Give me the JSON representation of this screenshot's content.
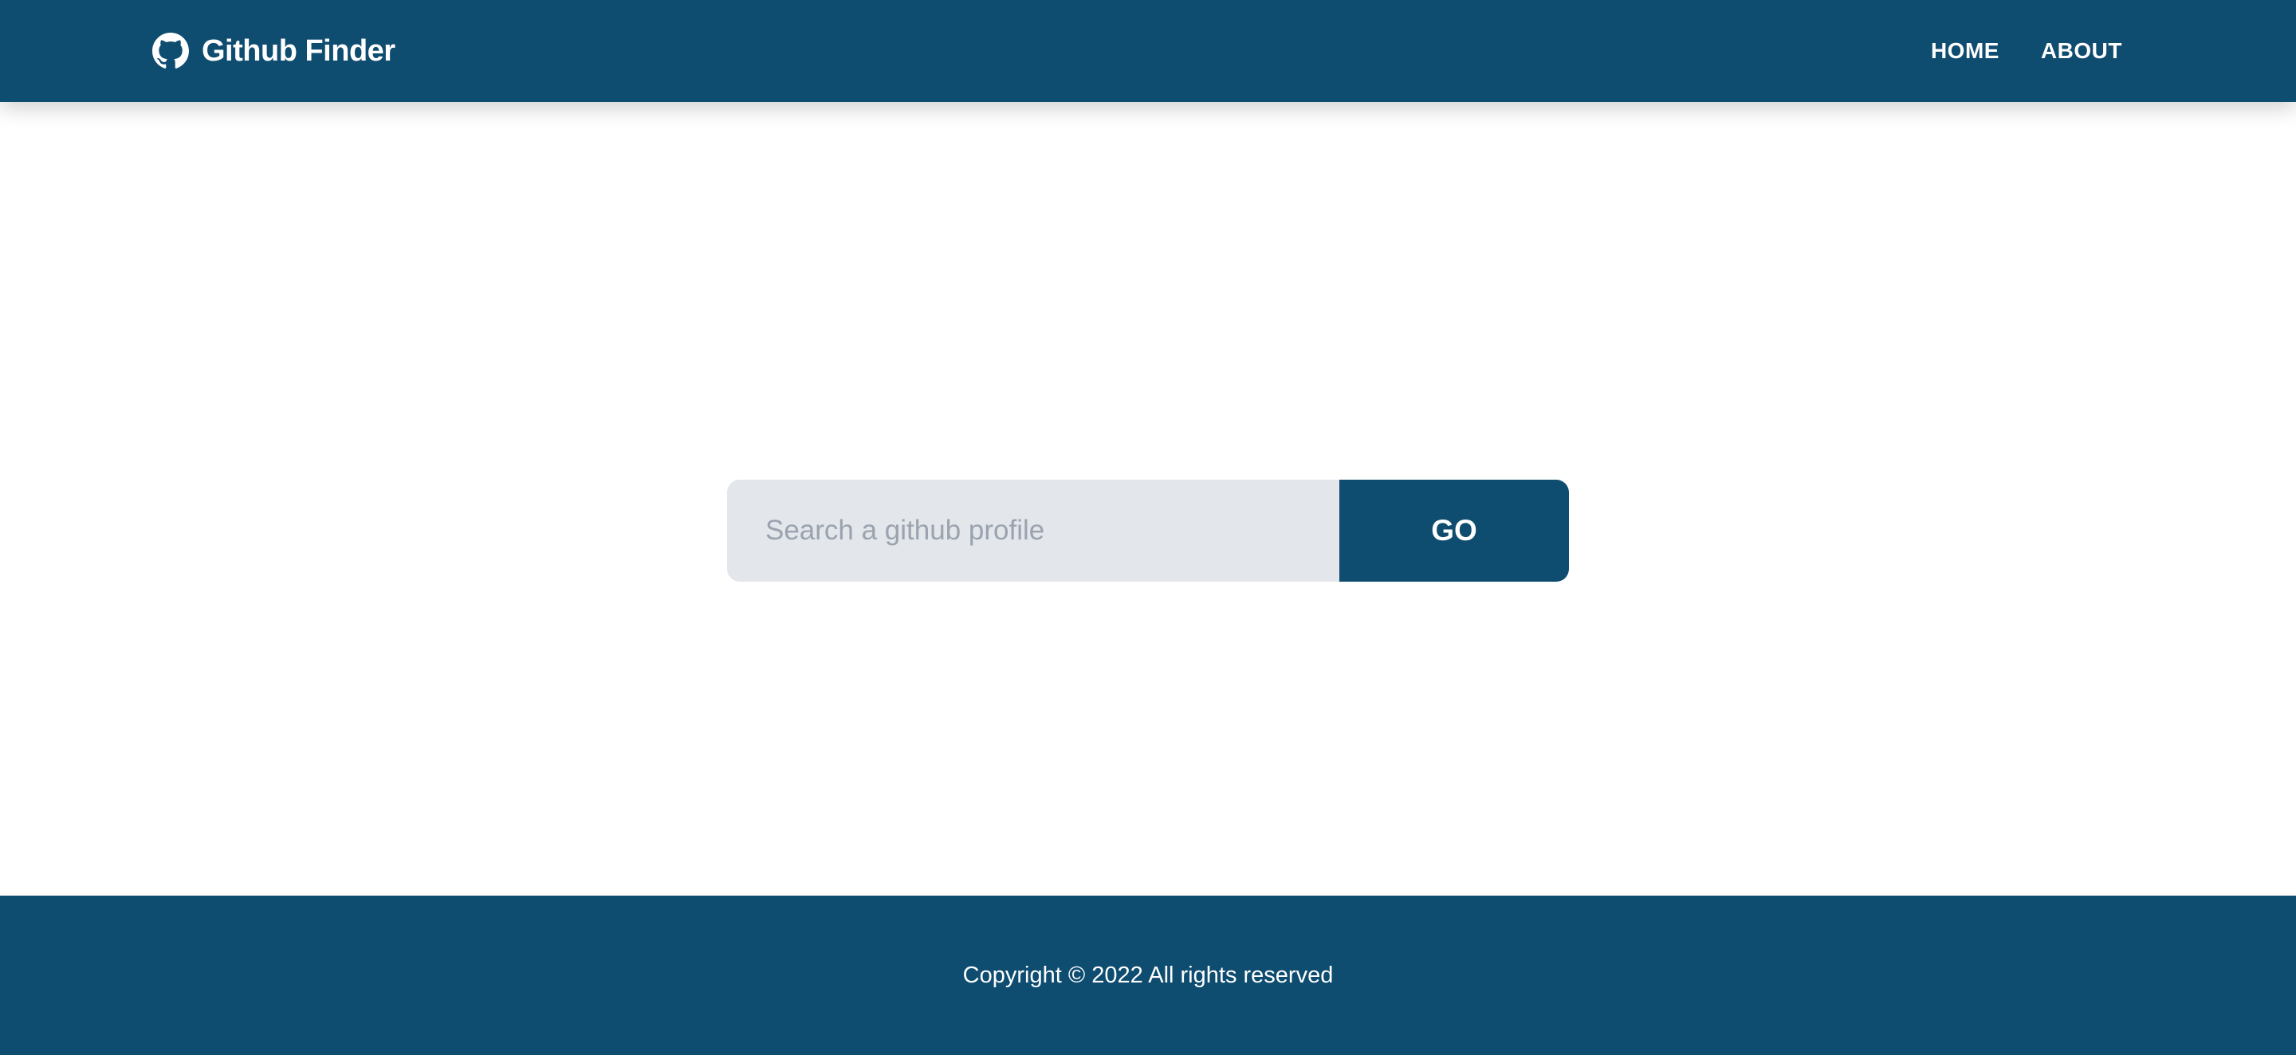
{
  "navbar": {
    "brand_icon": "github-icon",
    "brand_title": "Github Finder",
    "links": [
      {
        "label": "HOME"
      },
      {
        "label": "ABOUT"
      }
    ],
    "background": "#0e4c70"
  },
  "search": {
    "value": "",
    "placeholder": "Search a github profile",
    "button_label": "GO",
    "input_background": "#e3e6ea"
  },
  "footer": {
    "text": "Copyright © 2022 All rights reserved"
  }
}
